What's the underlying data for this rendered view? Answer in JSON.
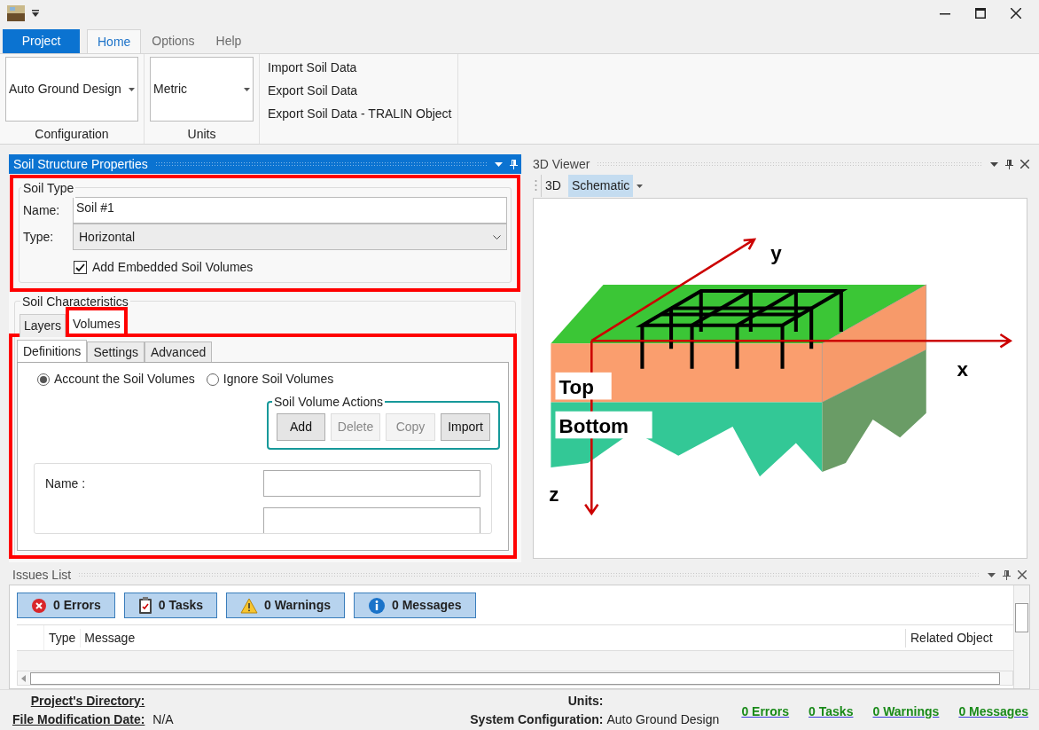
{
  "ribbon_tabs": [
    {
      "label": "Project",
      "kind": "backstage",
      "selected": false
    },
    {
      "label": "Home",
      "kind": "tab",
      "selected": true
    },
    {
      "label": "Options",
      "kind": "tab",
      "selected": false
    },
    {
      "label": "Help",
      "kind": "tab",
      "selected": false
    }
  ],
  "ribbon_groups": [
    {
      "kind": "dropdown",
      "value": "Auto Ground Design",
      "caption": "Configuration"
    },
    {
      "kind": "dropdown",
      "value": "Metric",
      "caption": "Units"
    },
    {
      "kind": "links",
      "items": [
        "Import Soil Data",
        "Export Soil Data",
        "Export Soil Data - TRALIN Object"
      ]
    }
  ],
  "soil_panel": {
    "title": "Soil Structure Properties",
    "soil_type": {
      "legend": "Soil Type",
      "highlighted": true,
      "name_label": "Name:",
      "name_value": "Soil #1",
      "type_label": "Type:",
      "type_value": "Horizontal",
      "embedded": {
        "label": "Add Embedded Soil Volumes",
        "checked": true
      }
    },
    "characteristics": {
      "legend": "Soil Characteristics",
      "panel_highlighted": true,
      "tabs": [
        {
          "label": "Layers",
          "selected": false,
          "highlighted": false
        },
        {
          "label": "Volumes",
          "selected": true,
          "highlighted": true
        }
      ],
      "subtabs": [
        {
          "label": "Definitions",
          "selected": true
        },
        {
          "label": "Settings",
          "selected": false
        },
        {
          "label": "Advanced",
          "selected": false
        }
      ],
      "radios": [
        {
          "label": "Account the Soil Volumes",
          "selected": true
        },
        {
          "label": "Ignore Soil Volumes",
          "selected": false
        }
      ],
      "actions": {
        "legend": "Soil Volume Actions",
        "buttons": [
          {
            "label": "Add",
            "disabled": false
          },
          {
            "label": "Delete",
            "disabled": true
          },
          {
            "label": "Copy",
            "disabled": true
          },
          {
            "label": "Import",
            "disabled": false
          }
        ]
      },
      "fields": [
        {
          "kind": "text",
          "label": "Name :"
        },
        {
          "kind": "text"
        }
      ]
    }
  },
  "viewer": {
    "title": "3D Viewer",
    "modes": [
      {
        "label": "3D",
        "selected": false
      },
      {
        "label": "Schematic",
        "selected": true
      }
    ],
    "schematic": {
      "axes": {
        "x": "x",
        "y": "y",
        "z": "z"
      },
      "layers": [
        "Top",
        "Bottom"
      ]
    }
  },
  "issues": {
    "title": "Issues List",
    "filters": [
      {
        "kind": "error",
        "label": "0 Errors"
      },
      {
        "kind": "task",
        "label": "0 Tasks"
      },
      {
        "kind": "warning",
        "label": "0 Warnings"
      },
      {
        "kind": "message",
        "label": "0 Messages"
      }
    ],
    "columns": [
      "Type",
      "Message",
      "Related Object"
    ]
  },
  "status_bar": {
    "left": [
      {
        "label": "Project's Directory:"
      },
      {
        "label": "File Modification Date:",
        "value": "N/A"
      }
    ],
    "center": [
      {
        "label": "Units:"
      },
      {
        "label": "System Configuration:",
        "value": "Auto Ground Design"
      }
    ],
    "links": [
      "0 Errors",
      "0 Tasks",
      "0 Warnings",
      "0 Messages"
    ]
  }
}
